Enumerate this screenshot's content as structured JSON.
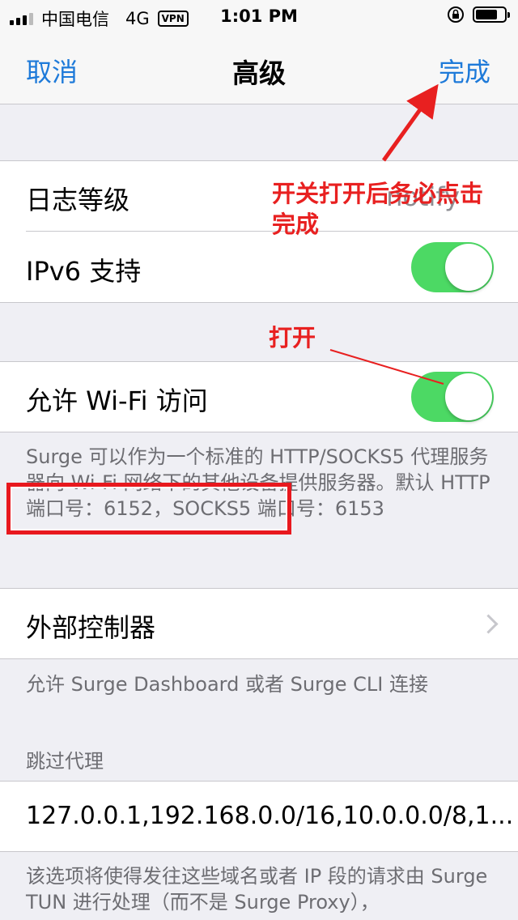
{
  "status_bar": {
    "carrier": "中国电信",
    "network": "4G",
    "vpn_badge": "VPN",
    "time": "1:01 PM"
  },
  "nav": {
    "cancel_label": "取消",
    "title": "高级",
    "done_label": "完成"
  },
  "rows": {
    "log_level": {
      "label": "日志等级",
      "value": "notify"
    },
    "ipv6": {
      "label": "IPv6 支持",
      "enabled": true
    },
    "wifi_access": {
      "label": "允许 Wi-Fi 访问",
      "enabled": true
    },
    "external_controller": {
      "label": "外部控制器"
    },
    "skip_proxy": {
      "value": "127.0.0.1,192.168.0.0/16,10.0.0.0/8,1..."
    }
  },
  "footers": {
    "wifi_access": "Surge 可以作为一个标准的 HTTP/SOCKS5 代理服务器向 Wi-Fi 网络下的其他设备提供服务器。默认 HTTP 端口号：6152，SOCKS5 端口号：6153",
    "external_controller": "允许 Surge Dashboard 或者 Surge CLI 连接",
    "skip_proxy": "该选项将使得发往这些域名或者 IP 段的请求由 Surge TUN 进行处理（而不是 Surge Proxy），"
  },
  "section_headers": {
    "skip_proxy": "跳过代理"
  },
  "annotations": {
    "done_note": "开关打开后务必点击完成",
    "open_note": "打开"
  },
  "colors": {
    "accent": "#1e7ad9",
    "toggle_on": "#4cd964",
    "annotation": "#e82020",
    "background": "#efeff4"
  }
}
